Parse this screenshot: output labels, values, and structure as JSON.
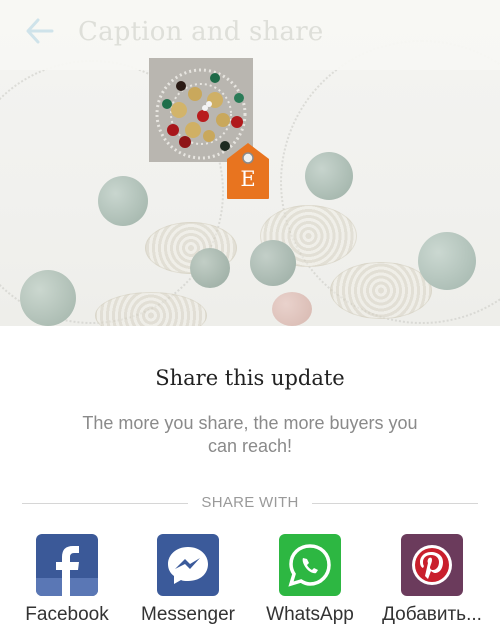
{
  "app_bar": {
    "title": "Caption and share",
    "back_icon": "arrow-left-icon"
  },
  "listing": {
    "platform_tag": {
      "letter": "E",
      "color": "#e8741f"
    }
  },
  "share_panel": {
    "heading": "Share this update",
    "description": "The more you share, the more buyers you can reach!",
    "section_label": "SHARE WITH",
    "targets": [
      {
        "label": "Facebook",
        "icon": "facebook-icon",
        "color": "#3b5998"
      },
      {
        "label": "Messenger",
        "icon": "messenger-icon",
        "color": "#3b5a9a"
      },
      {
        "label": "WhatsApp",
        "icon": "whatsapp-icon",
        "color": "#2db742"
      },
      {
        "label": "Добавить...",
        "icon": "pinterest-icon",
        "color": "#6b3b5c"
      }
    ]
  }
}
